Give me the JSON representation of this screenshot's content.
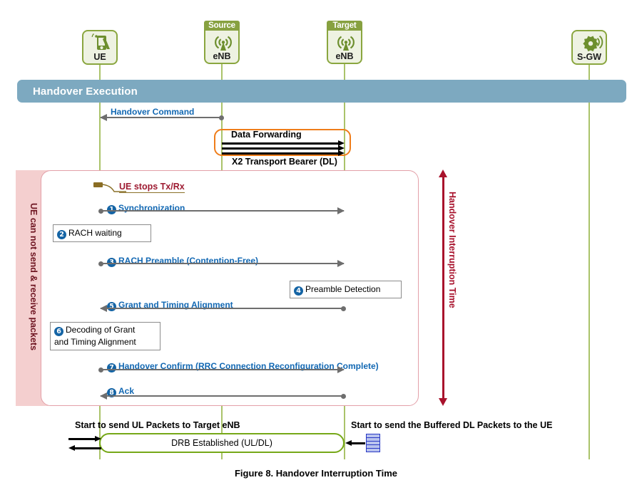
{
  "figure": {
    "caption": "Figure 8. Handover Interruption Time"
  },
  "actors": [
    {
      "id": "ue",
      "tag": "",
      "label": "UE",
      "icon": "mobile-phone-icon"
    },
    {
      "id": "source-enb",
      "tag": "Source",
      "label": "eNB",
      "icon": "base-station-icon"
    },
    {
      "id": "target-enb",
      "tag": "Target",
      "label": "eNB",
      "icon": "base-station-icon"
    },
    {
      "id": "sgw",
      "tag": "",
      "label": "S-GW",
      "icon": "gateway-gear-icon"
    }
  ],
  "banner": {
    "title": "Handover Execution"
  },
  "messages": [
    {
      "num": "",
      "label": "Handover Command",
      "dir": "left"
    },
    {
      "num": "1",
      "label": "Synchronization",
      "dir": "right"
    },
    {
      "num": "2",
      "label": "RACH waiting",
      "kind": "note"
    },
    {
      "num": "3",
      "label": "RACH Preamble (Contention-Free)",
      "dir": "right"
    },
    {
      "num": "4",
      "label": "Preamble Detection",
      "kind": "note"
    },
    {
      "num": "5",
      "label": "Grant and Timing Alignment",
      "dir": "left"
    },
    {
      "num": "6",
      "label": "Decoding of Grant\nand Timing Alignment",
      "kind": "note",
      "line1": "Decoding of Grant",
      "line2": "and Timing Alignment"
    },
    {
      "num": "7",
      "label": "Handover Confirm (RRC Connection Reconfiguration Complete)",
      "dir": "right"
    },
    {
      "num": "8",
      "label": "Ack",
      "dir": "left"
    }
  ],
  "data_forwarding": {
    "title": "Data Forwarding",
    "bearer_label": "X2 Transport Bearer (DL)",
    "stream_count": 3
  },
  "interruption": {
    "left_note": "UE can not send & receive packets",
    "right_note": "Handover Interruption Time",
    "ue_stops": "UE stops Tx/Rx"
  },
  "footer": {
    "ul_note": "Start to send UL Packets to Target eNB",
    "dl_note": "Start to send the Buffered DL Packets to the UE",
    "drb_label": "DRB Established (UL/DL)"
  },
  "colors": {
    "banner": "#7da9c0",
    "lifeline": "#aac36a",
    "actor_border": "#8aa63f",
    "actor_fill": "#eef2e2",
    "actor_tag": "#87a140",
    "message_text": "#1268b3",
    "badge": "#1464a5",
    "forwarding_border": "#ef7d1a",
    "interruption_band": "#f4cfcf",
    "interruption_text": "#6d1420",
    "hit_arrow": "#a8122c",
    "drb_border": "#76a818",
    "buffer": "#2838c4"
  }
}
